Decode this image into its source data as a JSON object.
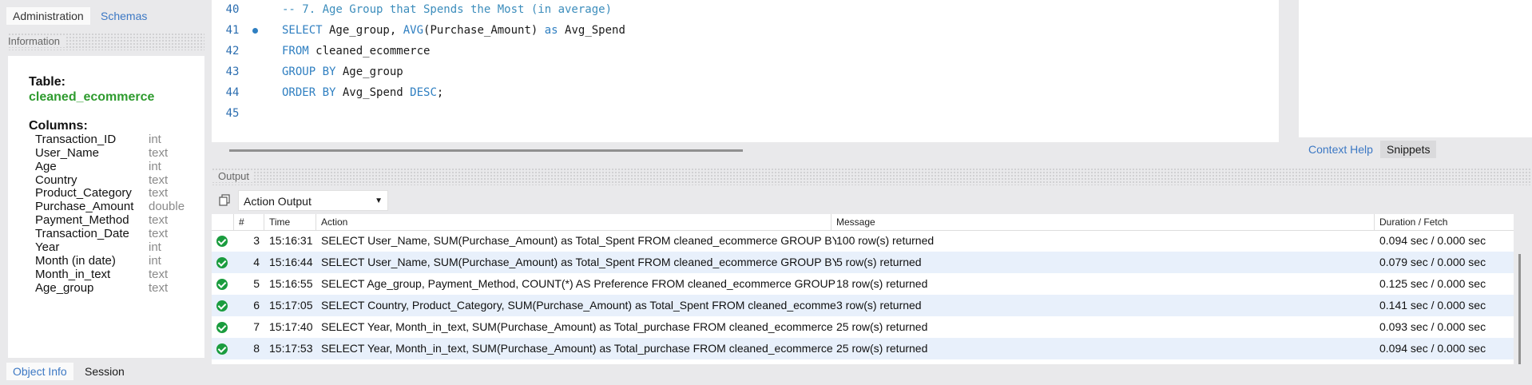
{
  "left_panel": {
    "top_tabs": [
      "Administration",
      "Schemas"
    ],
    "info_header": "Information",
    "table_label": "Table:",
    "table_name": "cleaned_ecommerce",
    "columns_label": "Columns:",
    "columns": [
      {
        "name": "Transaction_ID",
        "type": "int"
      },
      {
        "name": "User_Name",
        "type": "text"
      },
      {
        "name": "Age",
        "type": "int"
      },
      {
        "name": "Country",
        "type": "text"
      },
      {
        "name": "Product_Category",
        "type": "text"
      },
      {
        "name": "Purchase_Amount",
        "type": "double"
      },
      {
        "name": "Payment_Method",
        "type": "text"
      },
      {
        "name": "Transaction_Date",
        "type": "text"
      },
      {
        "name": "Year",
        "type": "int"
      },
      {
        "name": "Month (in date)",
        "type": "int"
      },
      {
        "name": "Month_in_text",
        "type": "text"
      },
      {
        "name": "Age_group",
        "type": "text"
      }
    ],
    "bottom_tabs": [
      "Object Info",
      "Session"
    ]
  },
  "editor": {
    "lines": [
      {
        "num": "40"
      },
      {
        "num": "41"
      },
      {
        "num": "42"
      },
      {
        "num": "43"
      },
      {
        "num": "44"
      },
      {
        "num": "45"
      }
    ],
    "tokens": {
      "comment": "-- 7. Age Group that Spends the Most (in average)",
      "select": "SELECT",
      "l41_a": " Age_group, ",
      "avg": "AVG",
      "l41_b": "(Purchase_Amount) ",
      "as": "as",
      "l41_c": " Avg_Spend",
      "from": "FROM",
      "l42": " cleaned_ecommerce",
      "groupby": "GROUP BY",
      "l43": " Age_group",
      "orderby": "ORDER BY",
      "l44_a": " Avg_Spend ",
      "desc": "DESC",
      "l44_b": ";"
    }
  },
  "right_panel": {
    "tabs": [
      "Context Help",
      "Snippets"
    ]
  },
  "output": {
    "header": "Output",
    "select_value": "Action Output",
    "columns": [
      "#",
      "Time",
      "Action",
      "Message",
      "Duration / Fetch"
    ],
    "rows": [
      {
        "num": "3",
        "time": "15:16:31",
        "action": "SELECT User_Name, SUM(Purchase_Amount) as Total_Spent FROM cleaned_ecommerce GROUP BY User...",
        "message": "100 row(s) returned",
        "duration": "0.094 sec / 0.000 sec"
      },
      {
        "num": "4",
        "time": "15:16:44",
        "action": "SELECT User_Name, SUM(Purchase_Amount) as Total_Spent FROM cleaned_ecommerce GROUP BY User...",
        "message": "5 row(s) returned",
        "duration": "0.079 sec / 0.000 sec"
      },
      {
        "num": "5",
        "time": "15:16:55",
        "action": "SELECT Age_group, Payment_Method, COUNT(*) AS Preference FROM cleaned_ecommerce GROUP BY Ag...",
        "message": "18 row(s) returned",
        "duration": "0.125 sec / 0.000 sec"
      },
      {
        "num": "6",
        "time": "15:17:05",
        "action": "SELECT Country, Product_Category, SUM(Purchase_Amount) as Total_Spent FROM cleaned_ecommerce G...",
        "message": "3 row(s) returned",
        "duration": "0.141 sec / 0.000 sec"
      },
      {
        "num": "7",
        "time": "15:17:40",
        "action": "SELECT Year, Month_in_text, SUM(Purchase_Amount) as Total_purchase FROM cleaned_ecommerce GRO...",
        "message": "25 row(s) returned",
        "duration": "0.093 sec / 0.000 sec"
      },
      {
        "num": "8",
        "time": "15:17:53",
        "action": "SELECT Year, Month_in_text, SUM(Purchase_Amount) as Total_purchase FROM cleaned_ecommerce GRO...",
        "message": "25 row(s) returned",
        "duration": "0.094 sec / 0.000 sec"
      }
    ]
  }
}
